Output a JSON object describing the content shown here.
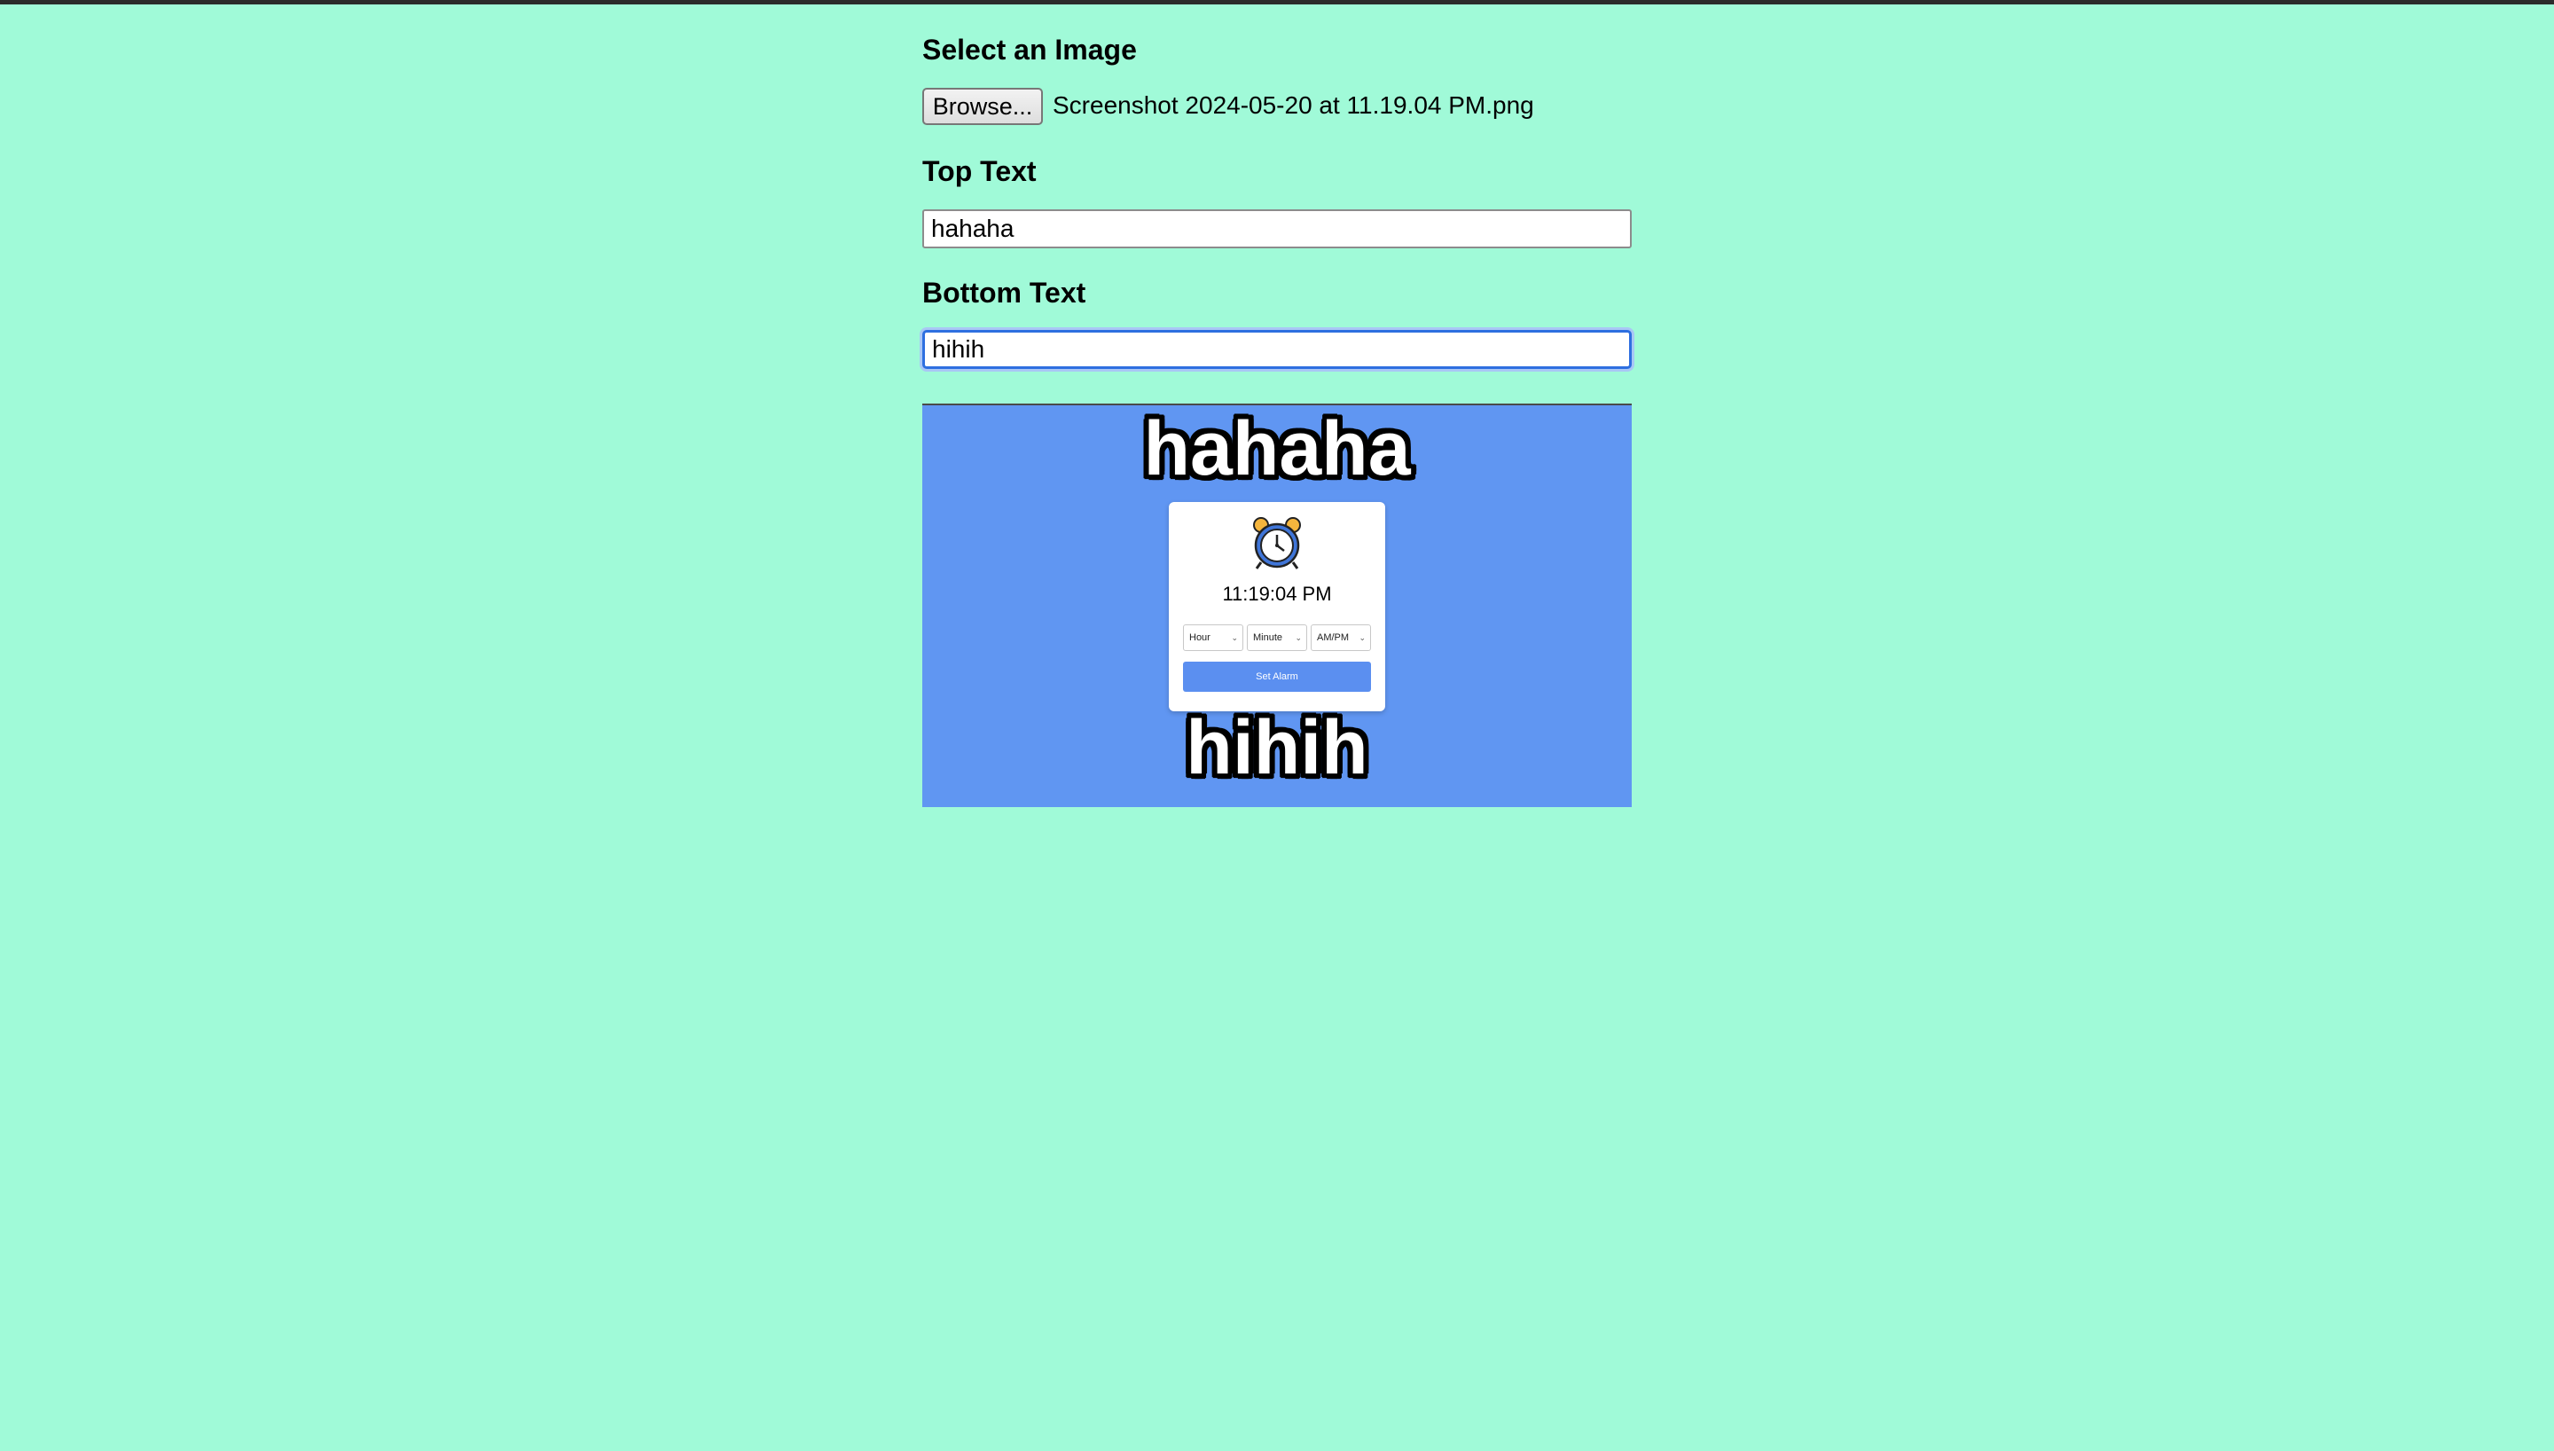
{
  "form": {
    "select_image_heading": "Select an Image",
    "browse_label": "Browse...",
    "file_name": "Screenshot 2024-05-20 at 11.19.04 PM.png",
    "top_text_heading": "Top Text",
    "top_text_value": "hahaha",
    "bottom_text_heading": "Bottom Text",
    "bottom_text_value": "hihih"
  },
  "meme": {
    "top_text": "hahaha",
    "bottom_text": "hihih",
    "background_color": "#6096f2",
    "embedded_card": {
      "icon": "alarm-clock-icon",
      "time": "11:19:04 PM",
      "selects": [
        "Hour",
        "Minute",
        "AM/PM"
      ],
      "button_label": "Set Alarm"
    }
  },
  "colors": {
    "page_background": "#a0fad8",
    "focus_ring": "#2e6fe0"
  }
}
